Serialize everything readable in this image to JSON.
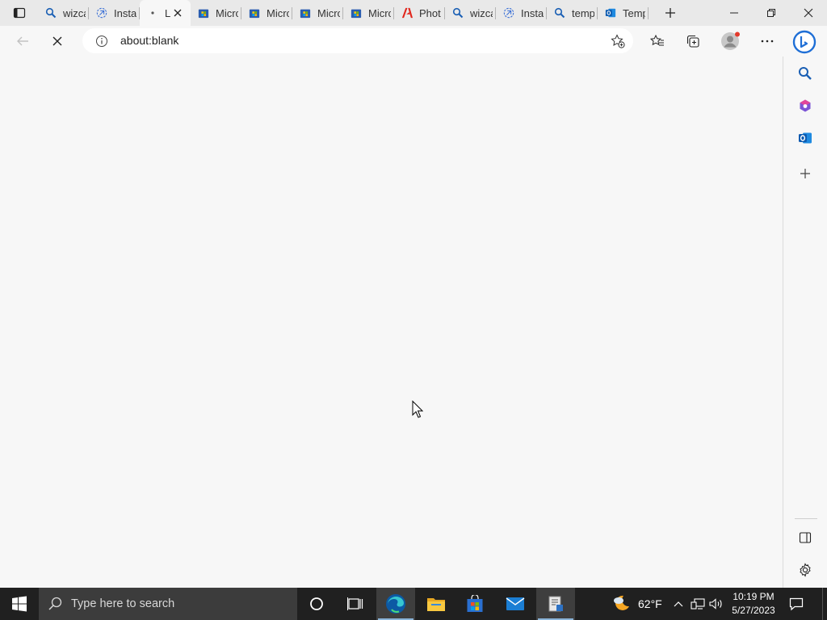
{
  "browser": {
    "tabs": [
      {
        "label": "wizca",
        "icon": "search-icon"
      },
      {
        "label": "Insta",
        "icon": "install-icon"
      },
      {
        "label": "L",
        "icon": "loading-dot-icon",
        "active": true
      },
      {
        "label": "Micro",
        "icon": "store-icon"
      },
      {
        "label": "Micro",
        "icon": "store-icon"
      },
      {
        "label": "Micro",
        "icon": "store-icon"
      },
      {
        "label": "Micro",
        "icon": "store-icon"
      },
      {
        "label": "Phot",
        "icon": "adobe-icon"
      },
      {
        "label": "wizca",
        "icon": "search-icon"
      },
      {
        "label": "Insta",
        "icon": "install-icon"
      },
      {
        "label": "temp",
        "icon": "search-icon"
      },
      {
        "label": "Temp",
        "icon": "outlook-tab-icon"
      }
    ],
    "address_url": "about:blank"
  },
  "taskbar": {
    "search_placeholder": "Type here to search",
    "weather_temp": "62°F",
    "time": "10:19 PM",
    "date": "5/27/2023"
  },
  "colors": {
    "edge_blue": "#0c59a4",
    "accent": "#1a73e8",
    "taskbar": "#202020"
  }
}
